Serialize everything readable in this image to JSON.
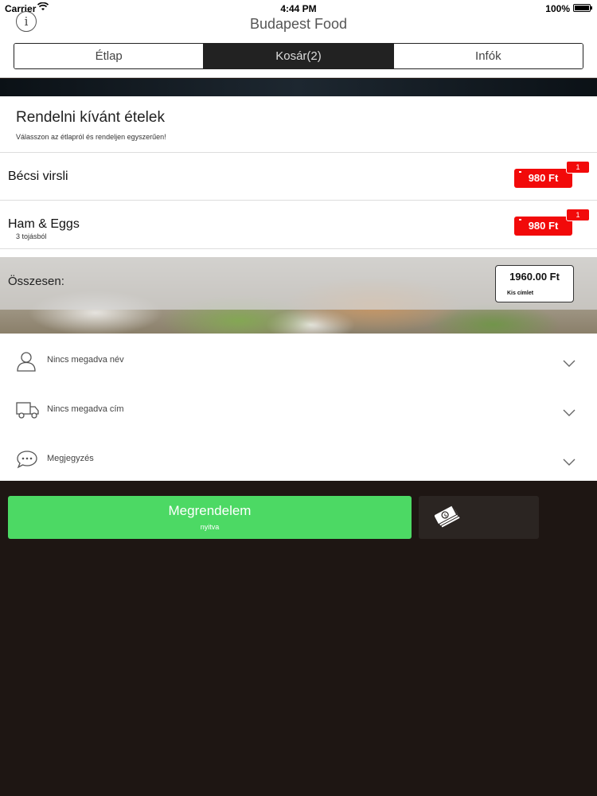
{
  "status_bar": {
    "carrier": "Carrier",
    "time": "4:44 PM",
    "battery": "100%"
  },
  "nav": {
    "title": "Budapest Food",
    "info_icon": "i"
  },
  "tabs": [
    {
      "label": "Étlap",
      "active": false
    },
    {
      "label": "Kosár(2)",
      "active": true
    },
    {
      "label": "Infók",
      "active": false
    }
  ],
  "cart": {
    "title": "Rendelni kívánt ételek",
    "subtitle": "Válasszon az étlapról és rendeljen egyszerűen!",
    "items": [
      {
        "name": "Bécsi virsli",
        "note": "",
        "price": "980 Ft",
        "quantity": "1"
      },
      {
        "name": "Ham & Eggs",
        "note": "3 tojásból",
        "price": "980 Ft",
        "quantity": "1"
      }
    ],
    "total_label": "Összesen:",
    "total_amount": "1960.00 Ft",
    "total_note": "Kis címlet"
  },
  "form": {
    "name_placeholder": "Nincs megadva név",
    "address_placeholder": "Nincs megadva cím",
    "comment_placeholder": "Megjegyzés"
  },
  "actions": {
    "order_label": "Megrendelem",
    "order_status": "nyitva",
    "payment_icon": "cash-icon"
  },
  "colors": {
    "accent_green": "#4cd964",
    "price_red": "#f20a0a",
    "dark_background": "#1e1613"
  }
}
